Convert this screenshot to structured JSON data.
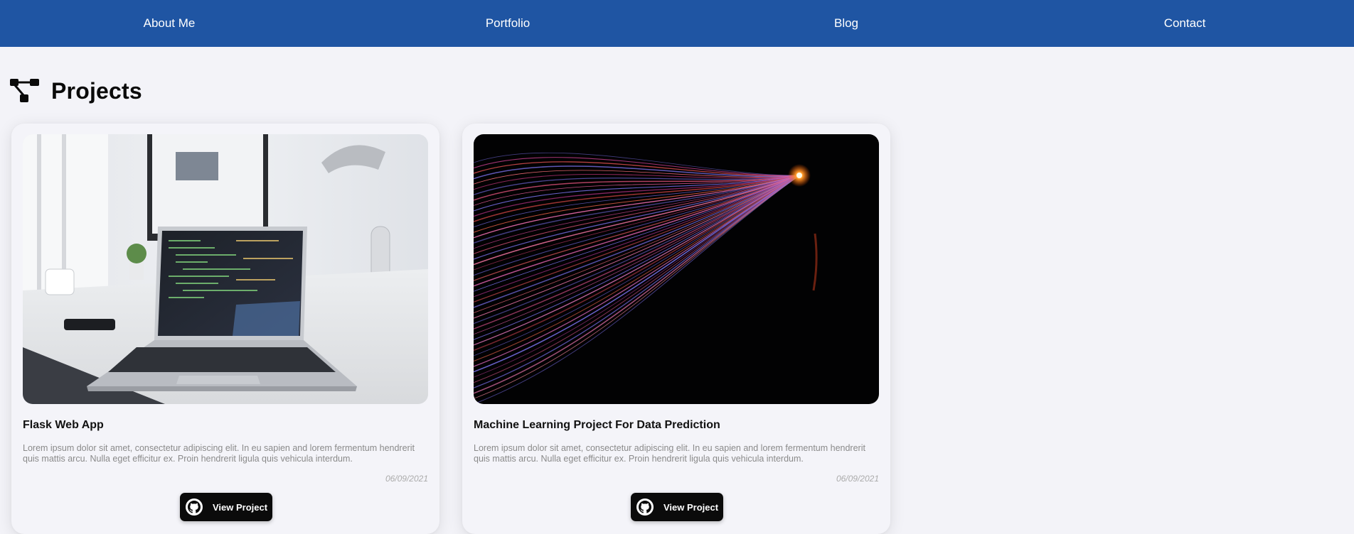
{
  "nav": {
    "items": [
      {
        "label": "About Me"
      },
      {
        "label": "Portfolio"
      },
      {
        "label": "Blog"
      },
      {
        "label": "Contact"
      }
    ]
  },
  "colors": {
    "nav_background": "#1f55a3",
    "page_background": "#f3f3f8",
    "button_background": "#0b0b0b"
  },
  "section": {
    "icon": "project-diagram-icon",
    "title": "Projects"
  },
  "projects": [
    {
      "image": "laptop-on-desk-photo",
      "title": "Flask Web App",
      "description": "Lorem ipsum dolor sit amet, consectetur adipiscing elit. In eu sapien and lorem fermentum hendrerit quis mattis arcu. Nulla eget efficitur ex. Proin hendrerit ligula quis vehicula interdum.",
      "date": "06/09/2021",
      "button_icon": "github-icon",
      "button_label": "View Project"
    },
    {
      "image": "light-strands-photo",
      "title": "Machine Learning Project For Data Prediction",
      "description": "Lorem ipsum dolor sit amet, consectetur adipiscing elit. In eu sapien and lorem fermentum hendrerit quis mattis arcu. Nulla eget efficitur ex. Proin hendrerit ligula quis vehicula interdum.",
      "date": "06/09/2021",
      "button_icon": "github-icon",
      "button_label": "View Project"
    }
  ]
}
